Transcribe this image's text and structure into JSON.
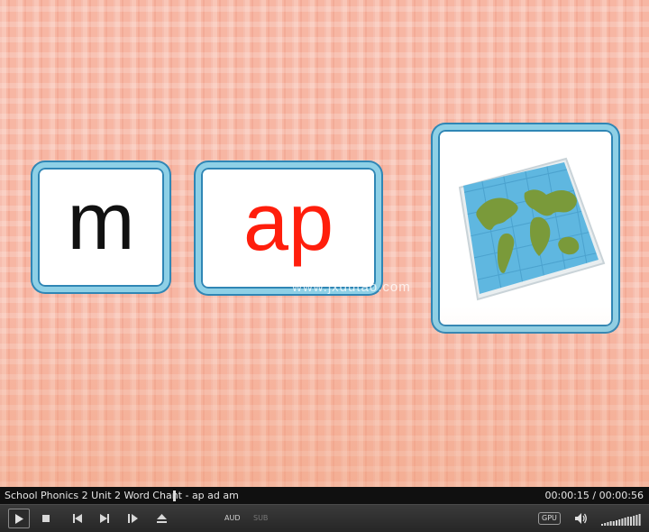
{
  "stage": {
    "cards": [
      {
        "id": "m",
        "text": "m",
        "color": "#111111"
      },
      {
        "id": "ap",
        "text": "ap",
        "color": "#ff1e0c"
      },
      {
        "id": "map",
        "image": "world-map-icon"
      }
    ],
    "watermark": "www.jxdutao.com"
  },
  "player": {
    "title": "School Phonics 2 Unit 2 Word Chant - ap ad am",
    "time": "00:00:15 / 00:00:56",
    "progress_fraction": 0.27,
    "buttons": {
      "aud_label": "AUD",
      "sub_label": "SUB",
      "gpu_label": "GPU"
    },
    "icons": [
      "play-icon",
      "stop-icon",
      "previous-icon",
      "next-icon",
      "step-forward-icon",
      "eject-icon",
      "volume-icon"
    ],
    "volume_level": 1.0
  }
}
